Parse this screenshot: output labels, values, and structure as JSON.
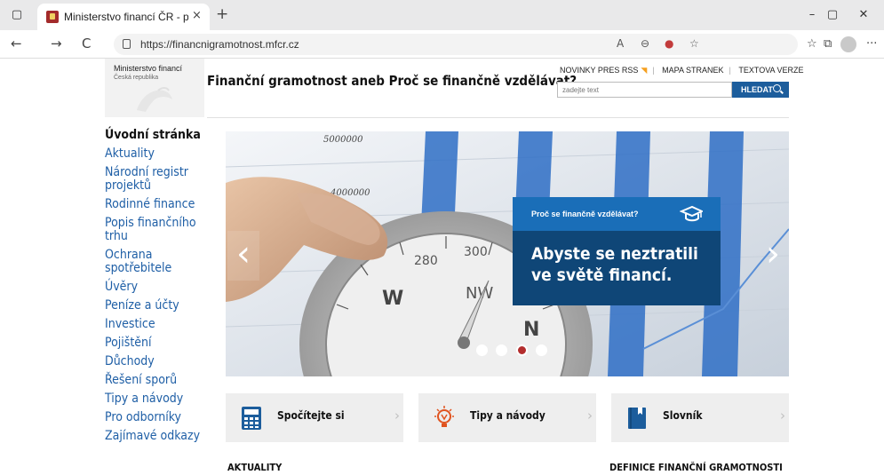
{
  "browser": {
    "tab": {
      "title": "Ministerstvo financí ČR - proč se",
      "close": "×"
    },
    "new_tab": "+",
    "window_controls": {
      "minimize": "–",
      "restore": "▢",
      "close": "✕"
    },
    "nav": {
      "back": "←",
      "forward": "→",
      "reload": "C"
    },
    "url": "https://financnigramotnost.mfcr.cz",
    "toolbar_icons": [
      "read-aloud-icon",
      "zoom-icon",
      "tracking-icon",
      "favorite-icon",
      "favorites-icon",
      "collections-icon",
      "profile-icon",
      "more-icon"
    ],
    "more": "···"
  },
  "header": {
    "logo_line1": "Ministerstvo financí",
    "logo_line2": "Česká republika",
    "title": "Finanční gramotnost aneb Proč se finančně vzdělávat?",
    "links": [
      "NOVINKY PRES RSS",
      "MAPA STRANEK",
      "TEXTOVA VERZE"
    ],
    "search_placeholder": "zadejte text",
    "search_button": "HLEDAT"
  },
  "sidebar": {
    "items": [
      {
        "label": "Úvodní stránka",
        "active": true
      },
      {
        "label": "Aktuality"
      },
      {
        "label": "Národní registr projektů"
      },
      {
        "label": "Rodinné finance"
      },
      {
        "label": "Popis finančního trhu"
      },
      {
        "label": "Ochrana spotřebitele"
      },
      {
        "label": "Úvěry"
      },
      {
        "label": "Peníze a účty"
      },
      {
        "label": "Investice"
      },
      {
        "label": "Pojištění"
      },
      {
        "label": "Důchody"
      },
      {
        "label": "Řešení sporů"
      },
      {
        "label": "Tipy a návody"
      },
      {
        "label": "Pro odborníky"
      },
      {
        "label": "Zajímavé odkazy"
      }
    ]
  },
  "hero": {
    "caption_label": "Proč se finančně vzdělávat?",
    "caption_text": "Abyste se neztratili ve světě financí.",
    "prev": "‹",
    "next": "›",
    "slides": 4,
    "active_slide": 3,
    "image_numbers": [
      "5000000",
      "4000000"
    ]
  },
  "features": [
    {
      "label": "Spočítejte si",
      "icon": "calculator-icon"
    },
    {
      "label": "Tipy a návody",
      "icon": "lightbulb-icon"
    },
    {
      "label": "Slovník",
      "icon": "book-icon"
    }
  ],
  "sections": {
    "news": "AKTUALITY",
    "definition": "DEFINICE FINANČNÍ GRAMOTNOSTI"
  },
  "colors": {
    "link": "#1f5fa6",
    "caption_light": "#1a6eb8",
    "caption_dark": "#0f4677",
    "active_dot": "#b32d2d"
  }
}
